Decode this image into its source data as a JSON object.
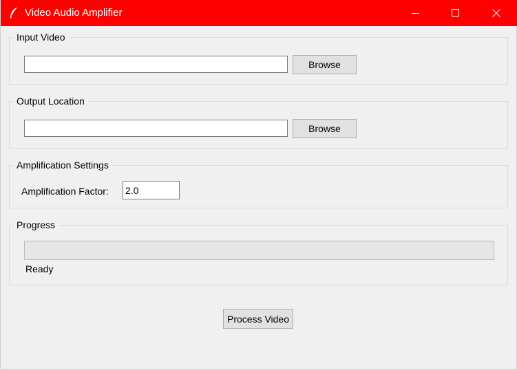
{
  "window": {
    "title": "Video Audio Amplifier",
    "titlebar_color": "#ff0000",
    "icon": "feather-icon",
    "controls": [
      "minimize-icon",
      "maximize-icon",
      "close-icon"
    ]
  },
  "input_video": {
    "group_label": "Input Video",
    "path_value": "",
    "browse_label": "Browse"
  },
  "output_location": {
    "group_label": "Output Location",
    "path_value": "",
    "browse_label": "Browse"
  },
  "amplification": {
    "group_label": "Amplification Settings",
    "factor_label": "Amplification Factor:",
    "factor_value": "2.0"
  },
  "progress": {
    "group_label": "Progress",
    "value_percent": 0,
    "status": "Ready"
  },
  "actions": {
    "process_label": "Process Video"
  }
}
